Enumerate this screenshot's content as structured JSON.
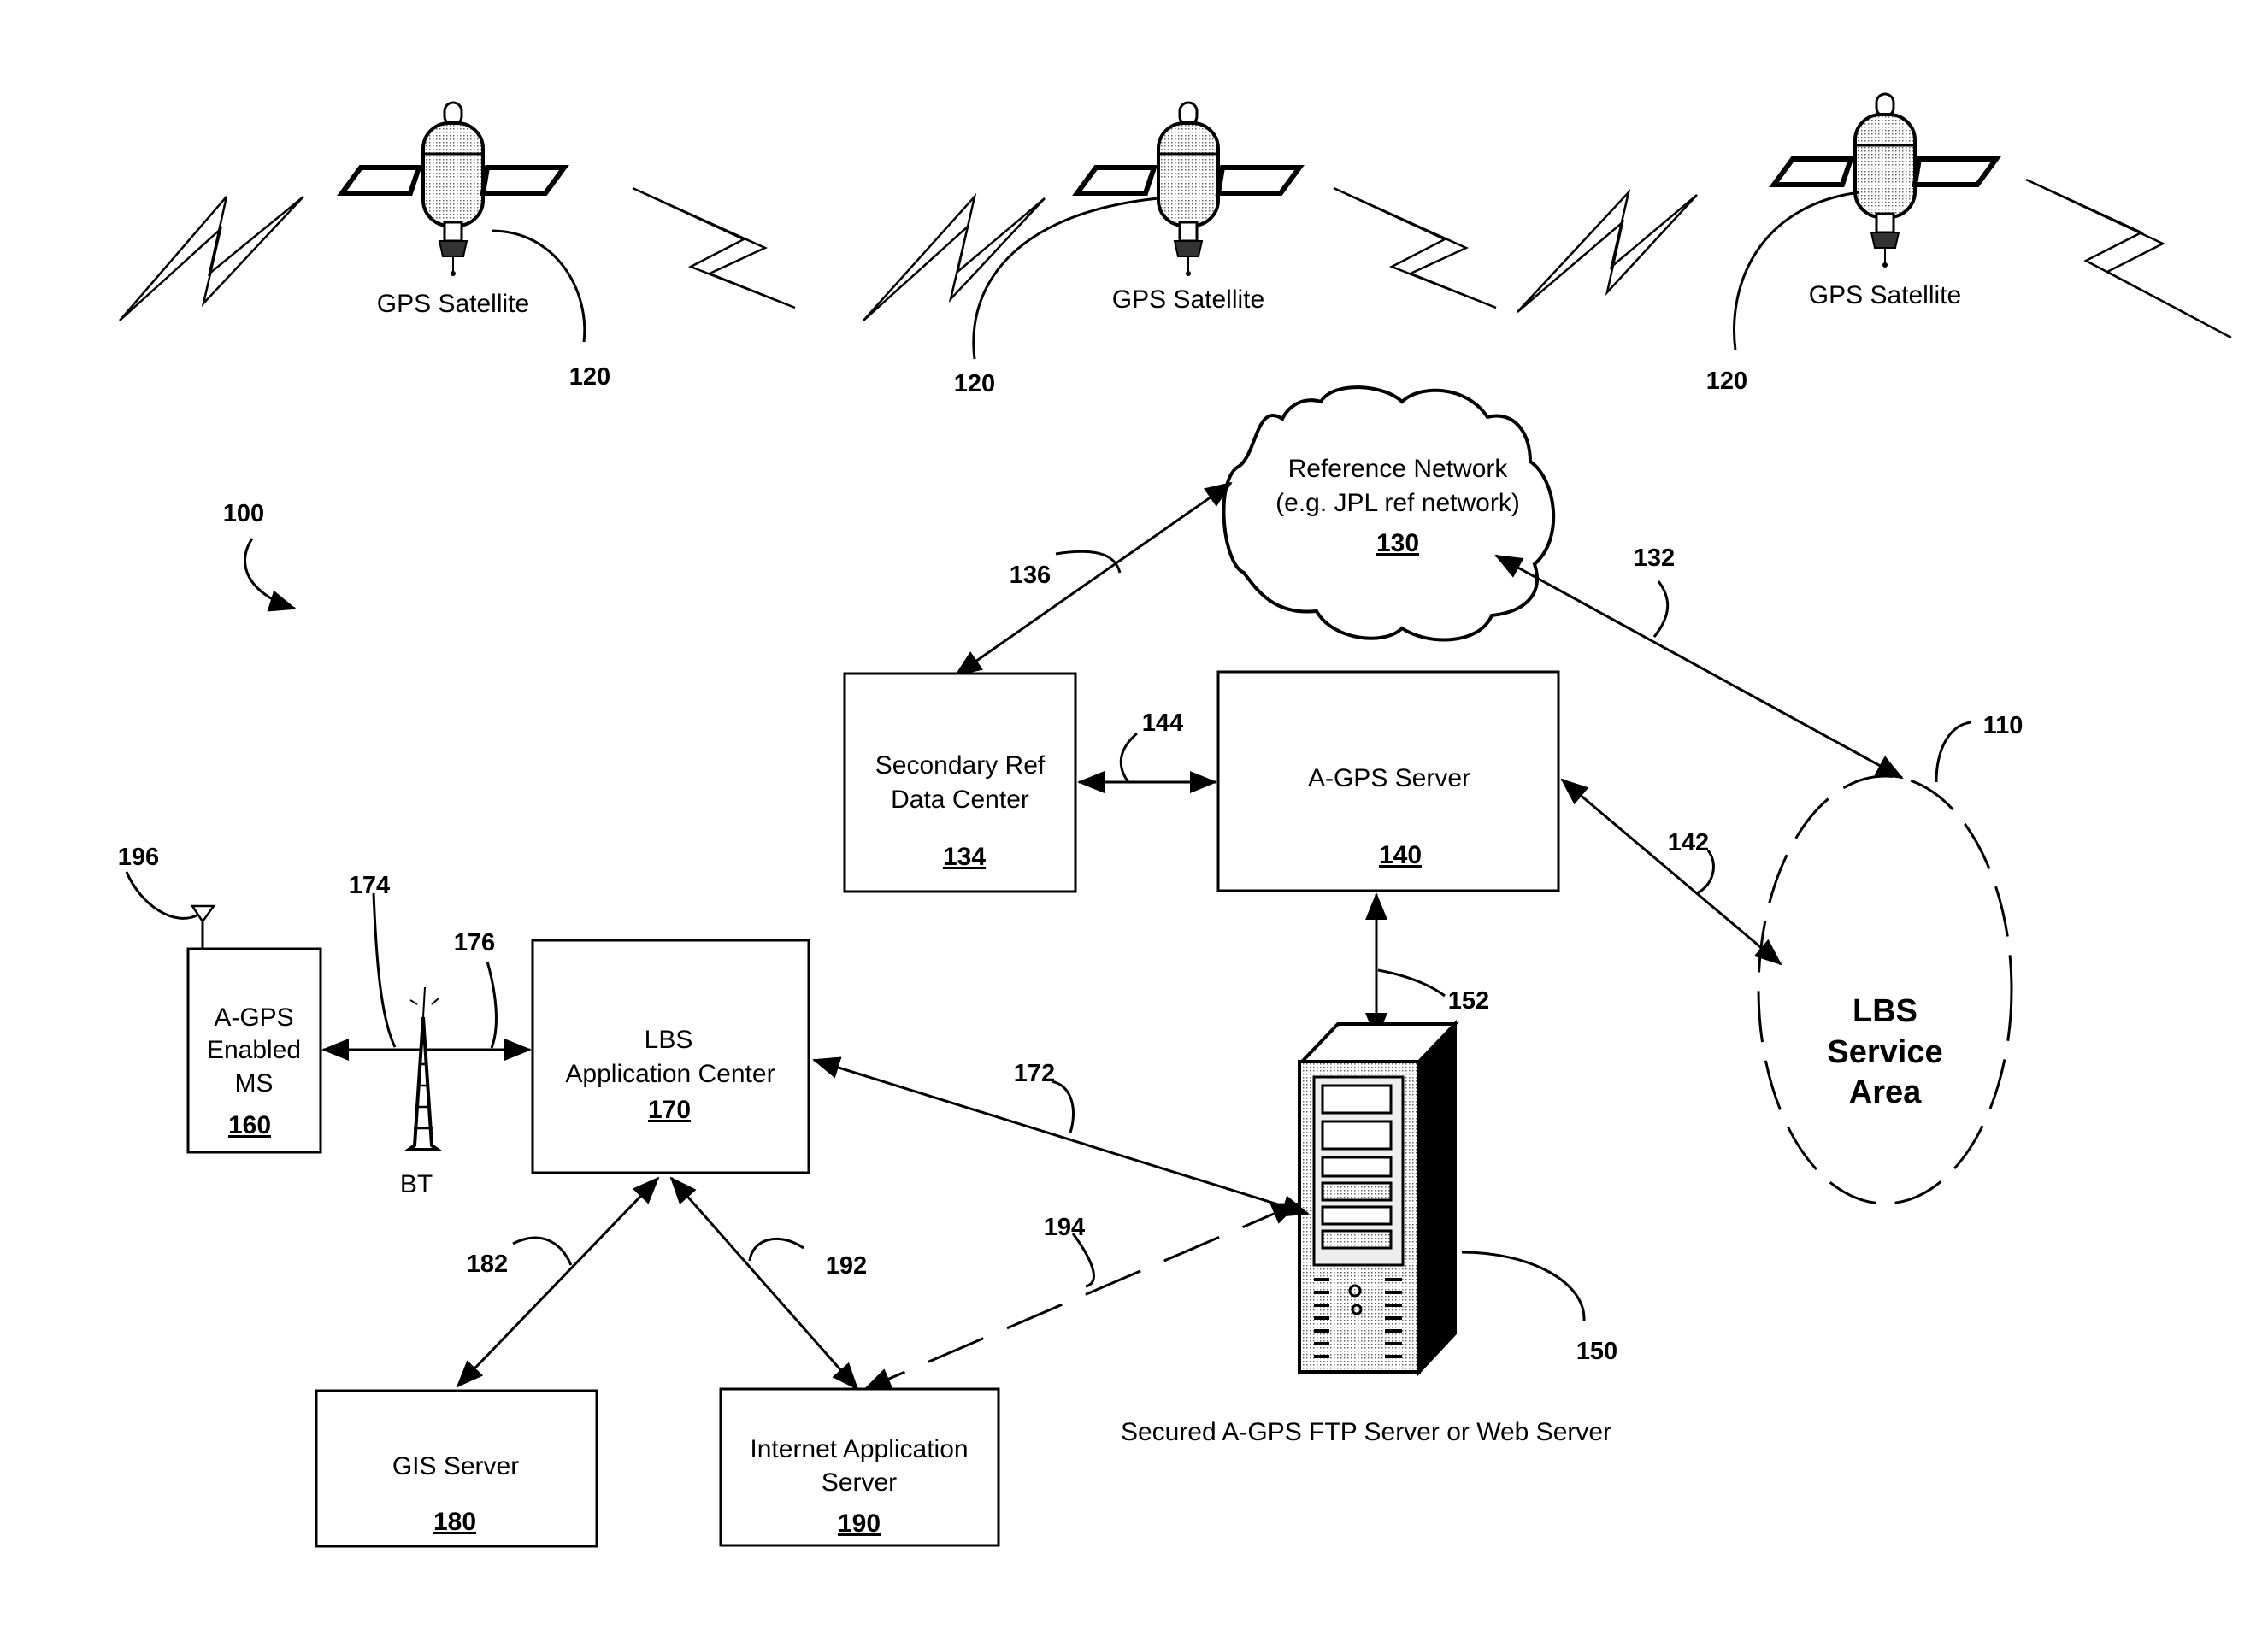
{
  "figure": {
    "system_ref": "100",
    "satellites": [
      {
        "label": "GPS Satellite",
        "ref": "120"
      },
      {
        "label": "GPS Satellite",
        "ref": "120"
      },
      {
        "label": "GPS Satellite",
        "ref": "120"
      }
    ],
    "reference_network": {
      "line1": "Reference Network",
      "line2": "(e.g. JPL ref network)",
      "ref": "130"
    },
    "secondary_ref": {
      "line1": "Secondary Ref",
      "line2": "Data Center",
      "ref": "134"
    },
    "agps_server": {
      "line1": "A-GPS Server",
      "ref": "140"
    },
    "lbs_area": {
      "line1": "LBS",
      "line2": "Service",
      "line3": "Area",
      "ref": "110"
    },
    "ftp_server": {
      "caption": "Secured A-GPS FTP Server or Web Server",
      "ref": "150"
    },
    "mobile": {
      "line1": "A-GPS",
      "line2": "Enabled",
      "line3": "MS",
      "ref": "160",
      "antenna_ref": "196"
    },
    "tower": {
      "label": "BT",
      "ref": "174"
    },
    "lbs_center": {
      "line1": "LBS",
      "line2": "Application Center",
      "ref": "170"
    },
    "gis_server": {
      "line1": "GIS Server",
      "ref": "180"
    },
    "internet_server": {
      "line1": "Internet Application",
      "line2": "Server",
      "ref": "190"
    },
    "links": {
      "l136": "136",
      "l132": "132",
      "l144": "144",
      "l142": "142",
      "l152": "152",
      "l176": "176",
      "l172": "172",
      "l182": "182",
      "l192": "192",
      "l194": "194"
    }
  }
}
